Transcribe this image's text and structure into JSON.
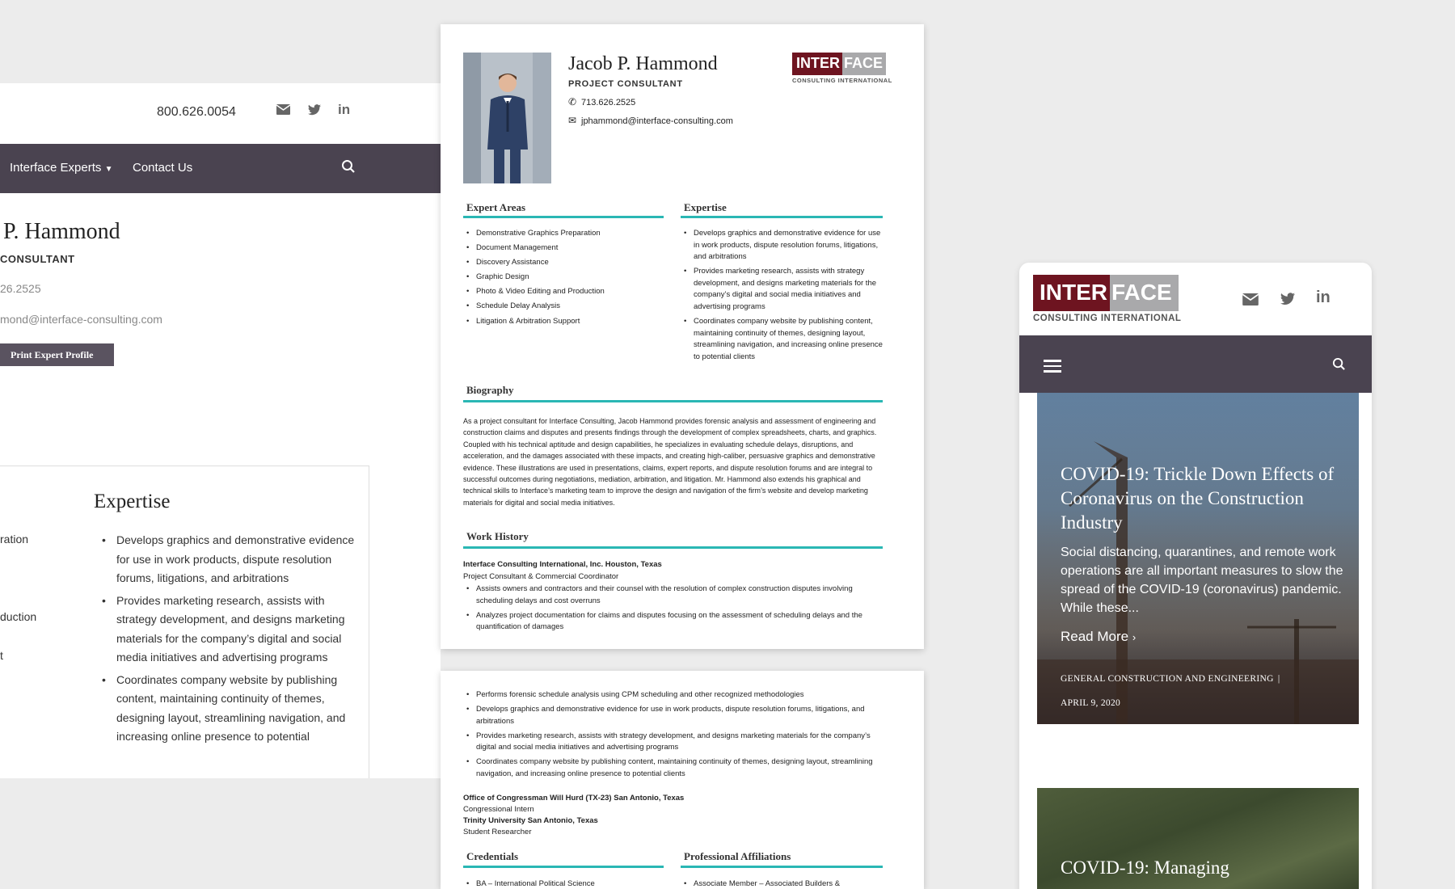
{
  "desktop": {
    "phone": "800.626.0054",
    "nav": {
      "experts": "Interface Experts",
      "contact": "Contact Us"
    },
    "name": "P. Hammond",
    "title": "CONSULTANT",
    "phone2": "26.2525",
    "email2": "mond@interface-consulting.com",
    "print_btn": "Print Expert Profile",
    "expertise_heading": "Expertise",
    "left_fragments": [
      "ration",
      "duction",
      "t"
    ],
    "expertise_items": [
      "Develops graphics and demonstrative evidence for use in work products, dispute resolution forums, litigations, and arbitrations",
      "Provides marketing research, assists with strategy development, and designs marketing materials for the company’s digital and social media initiatives and advertising programs",
      "Coordinates company website by publishing content, maintaining continuity of themes, designing layout, streamlining navigation, and increasing online presence to potential"
    ]
  },
  "logo": {
    "part1": "INTER",
    "part2": "FACE",
    "sub": "CONSULTING INTERNATIONAL"
  },
  "resume": {
    "name": "Jacob P. Hammond",
    "title": "PROJECT CONSULTANT",
    "phone": "713.626.2525",
    "email": "jphammond@interface-consulting.com",
    "expert_areas_heading": "Expert Areas",
    "expert_areas": [
      "Demonstrative Graphics Preparation",
      "Document Management",
      "Discovery Assistance",
      "Graphic Design",
      "Photo & Video Editing and Production",
      "Schedule Delay Analysis",
      "Litigation & Arbitration Support"
    ],
    "expertise_heading": "Expertise",
    "expertise": [
      "Develops graphics and demonstrative evidence for use in work products, dispute resolution forums, litigations, and arbitrations",
      "Provides marketing research, assists with strategy development, and designs marketing materials for the company’s digital and social media initiatives and advertising programs",
      "Coordinates company website by publishing content, maintaining continuity of themes, designing layout, streamlining navigation, and increasing online presence to potential clients"
    ],
    "biography_heading": "Biography",
    "biography": "As a project consultant for Interface Consulting, Jacob Hammond provides forensic analysis and assessment of engineering and construction claims and disputes and presents findings through the development of complex spreadsheets, charts, and graphics. Coupled with his technical aptitude and design capabilities, he specializes in evaluating schedule delays, disruptions, and acceleration, and the damages associated with these impacts, and creating high-caliber, persuasive graphics and demonstrative evidence. These illustrations are used in presentations, claims, expert reports, and dispute resolution forums and are integral to successful outcomes during negotiations, mediation, arbitration, and litigation. Mr. Hammond also extends his graphical and technical skills to Interface’s marketing team to improve the design and navigation of the firm’s website and develop marketing materials for digital and social media initiatives.",
    "work_history_heading": "Work History",
    "work1_company": "Interface Consulting International, Inc. Houston, Texas",
    "work1_role": "Project Consultant & Commercial Coordinator",
    "work1_items": [
      "Assists owners and contractors and their counsel with the resolution of complex construction disputes involving scheduling delays and cost overruns",
      "Analyzes project documentation for claims and disputes focusing on the assessment of scheduling delays and the quantification of damages"
    ],
    "page2_items": [
      "Performs forensic schedule analysis using CPM scheduling and other recognized methodologies",
      "Develops graphics and demonstrative evidence for use in work products, dispute resolution forums, litigations, and arbitrations",
      "Provides marketing research, assists with strategy development, and designs marketing materials for the company’s digital and social media initiatives and advertising programs",
      "Coordinates company website by publishing content, maintaining continuity of themes, designing layout, streamlining navigation, and increasing online presence to potential clients"
    ],
    "work2_company": "Office of Congressman Will Hurd (TX-23) San Antonio, Texas",
    "work2_role": "Congressional Intern",
    "work3_company": "Trinity University San Antonio, Texas",
    "work3_role": "Student Researcher",
    "credentials_heading": "Credentials",
    "credentials_item": "BA – International Political Science",
    "affiliations_heading": "Professional Affiliations",
    "affiliations_item": "Associate Member – Associated Builders &"
  },
  "mobile": {
    "article1": {
      "title": "COVID-19: Trickle Down Effects of Coronavirus on the Construction Industry",
      "excerpt": "Social distancing, quarantines, and remote work operations are all important measures to slow the spread of the COVID-19 (coronavirus) pandemic. While these...",
      "read_more": "Read More",
      "category": "GENERAL CONSTRUCTION AND ENGINEERING",
      "date": "APRIL 9, 2020"
    },
    "article2": {
      "title": "COVID-19: Managing"
    }
  },
  "colors": {
    "nav": "#4a4350",
    "accent": "#2ab7b4",
    "brand": "#6e1420"
  }
}
